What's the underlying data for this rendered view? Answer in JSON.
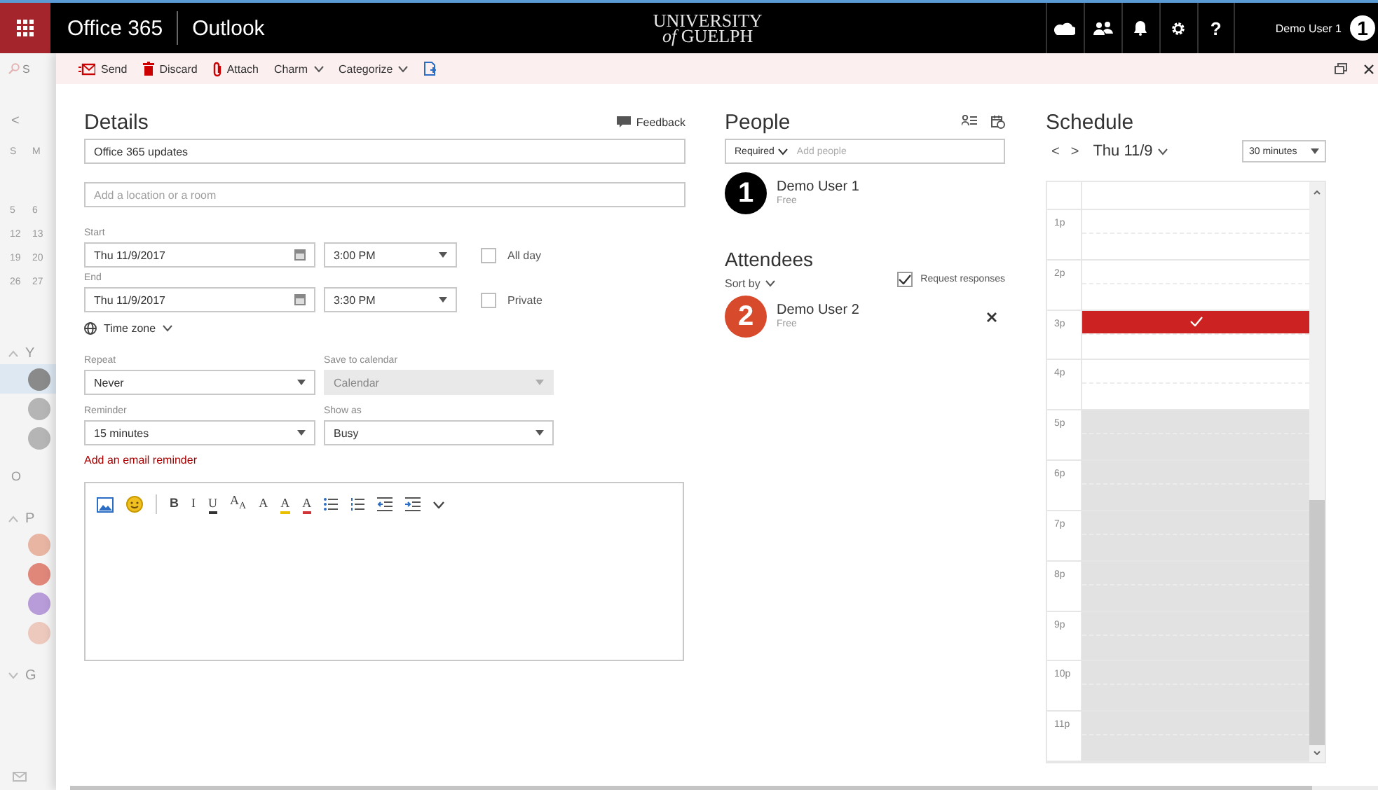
{
  "app_bar": {
    "app_name": "Office 365",
    "module": "Outlook",
    "logo_line_1": "UNIVERSITY",
    "logo_line_2": "*of* GUELPH",
    "help_label": "?",
    "user_name": "Demo User 1",
    "user_badge": "1"
  },
  "background_pane": {
    "search_text": "S",
    "back_label": "<",
    "weekdays": [
      "S",
      "M"
    ],
    "weeks": [
      [
        "5",
        "6"
      ],
      [
        "12",
        "13"
      ],
      [
        "19",
        "20"
      ],
      [
        "26",
        "27"
      ]
    ],
    "sections": [
      {
        "label": "Y",
        "expanded": true,
        "items": [
          {
            "kind": "avatar",
            "color": "#8a8a8a",
            "selected": true
          },
          {
            "kind": "avatar",
            "color": "#b5b5b5",
            "selected": false
          },
          {
            "kind": "avatar",
            "color": "#b5b5b5",
            "selected": false
          },
          {
            "kind": "text",
            "label": "O",
            "selected": false
          }
        ]
      },
      {
        "label": "P",
        "expanded": true,
        "items": [
          {
            "kind": "avatar",
            "color": "#e8b5a3",
            "selected": false
          },
          {
            "kind": "avatar",
            "color": "#e0877a",
            "selected": false
          },
          {
            "kind": "avatar",
            "color": "#b89bd9",
            "selected": false
          },
          {
            "kind": "avatar",
            "color": "#ecc8bd",
            "selected": false
          }
        ]
      },
      {
        "label": "G",
        "expanded": false
      }
    ]
  },
  "toolbar": {
    "commands": [
      {
        "kind": "labeled",
        "label": "Send",
        "has_menu": false
      },
      {
        "kind": "labeled",
        "label": "Discard",
        "has_menu": false
      },
      {
        "kind": "labeled",
        "label": "Attach",
        "has_menu": false
      },
      {
        "kind": "labeled",
        "label": "Charm",
        "has_menu": true
      },
      {
        "kind": "labeled",
        "label": "Categorize",
        "has_menu": true
      },
      {
        "kind": "icon",
        "has_menu": false
      }
    ]
  },
  "details": {
    "title": "Details",
    "feedback_label": "Feedback",
    "subject_value": "Office 365 updates",
    "location_placeholder": "Add a location or a room",
    "start": {
      "label": "Start",
      "date": "Thu 11/9/2017",
      "time": "3:00 PM"
    },
    "all_day": {
      "label": "All day",
      "checked": false
    },
    "end": {
      "label": "End",
      "date": "Thu 11/9/2017",
      "time": "3:30 PM"
    },
    "private": {
      "label": "Private",
      "checked": false
    },
    "time_zone_label": "Time zone",
    "repeat": {
      "label": "Repeat",
      "value": "Never",
      "disabled": false
    },
    "save_to_calendar": {
      "label": "Save to calendar",
      "value": "Calendar",
      "disabled": true
    },
    "reminder": {
      "label": "Reminder",
      "value": "15 minutes",
      "disabled": false
    },
    "show_as": {
      "label": "Show as",
      "value": "Busy",
      "disabled": false
    },
    "email_reminder_link": "Add an email reminder",
    "editor_tools": [
      {
        "kind": "icon"
      },
      {
        "kind": "icon"
      },
      {
        "kind": "separator"
      },
      {
        "kind": "text",
        "label": "B"
      },
      {
        "kind": "text",
        "label": "I"
      },
      {
        "kind": "text",
        "label": "U",
        "color": "#333333"
      },
      {
        "kind": "text",
        "label": "A$_{A}$"
      },
      {
        "kind": "text",
        "label": "A"
      },
      {
        "kind": "text",
        "label": "A",
        "color": "#e8c000"
      },
      {
        "kind": "text",
        "label": "A",
        "color": "#d13438"
      },
      {
        "kind": "icon"
      },
      {
        "kind": "icon"
      },
      {
        "kind": "icon"
      },
      {
        "kind": "icon"
      },
      {
        "kind": "icon"
      }
    ]
  },
  "people": {
    "title": "People",
    "role": "Required",
    "add_placeholder": "Add people",
    "organizer": {
      "badge": "1",
      "name": "Demo User 1",
      "status": "Free"
    },
    "attendees_title": "Attendees",
    "sort_label": "Sort by",
    "request_responses": {
      "label": "Request responses",
      "checked": true
    },
    "attendees": [
      {
        "badge": "2",
        "name": "Demo User 2",
        "status": "Free"
      }
    ]
  },
  "schedule": {
    "title": "Schedule",
    "prev": "<",
    "next": ">",
    "date": "Thu 11/9",
    "interval": "30 minutes",
    "hours": [
      {
        "label": "1p",
        "busy": false,
        "shaded": false
      },
      {
        "label": "2p",
        "busy": false,
        "shaded": false
      },
      {
        "label": "3p",
        "busy": true,
        "shaded": false
      },
      {
        "label": "4p",
        "busy": false,
        "shaded": false
      },
      {
        "label": "5p",
        "busy": false,
        "shaded": true
      },
      {
        "label": "6p",
        "busy": false,
        "shaded": true
      },
      {
        "label": "7p",
        "busy": false,
        "shaded": true
      },
      {
        "label": "8p",
        "busy": false,
        "shaded": true
      },
      {
        "label": "9p",
        "busy": false,
        "shaded": true
      },
      {
        "label": "10p",
        "busy": false,
        "shaded": true
      },
      {
        "label": "11p",
        "busy": false,
        "shaded": true
      }
    ]
  }
}
